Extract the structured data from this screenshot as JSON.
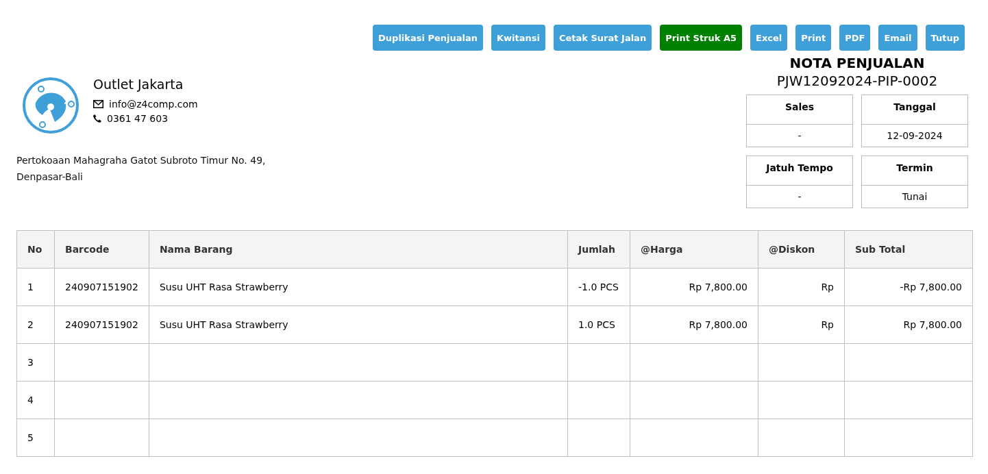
{
  "toolbar": [
    {
      "label": "Duplikasi Penjualan",
      "color": "#3e9fd9"
    },
    {
      "label": "Kwitansi",
      "color": "#3e9fd9"
    },
    {
      "label": "Cetak Surat Jalan",
      "color": "#3e9fd9"
    },
    {
      "label": "Print Struk A5",
      "color": "#008000"
    },
    {
      "label": "Excel",
      "color": "#3e9fd9"
    },
    {
      "label": "Print",
      "color": "#3e9fd9"
    },
    {
      "label": "PDF",
      "color": "#3e9fd9"
    },
    {
      "label": "Email",
      "color": "#3e9fd9"
    },
    {
      "label": "Tutup",
      "color": "#3e9fd9"
    }
  ],
  "company": {
    "name": "Outlet Jakarta",
    "email": "info@z4comp.com",
    "phone": "0361 47 603",
    "address": [
      "Pertokoaan Mahagraha Gatot Subroto Timur No. 49,",
      "Denpasar-Bali"
    ]
  },
  "nota": {
    "title": "NOTA PENJUALAN",
    "number": "PJW12092024-PIP-0002",
    "fields": [
      {
        "label": "Sales",
        "value": "-"
      },
      {
        "label": "Tanggal",
        "value": "12-09-2024"
      },
      {
        "label": "Jatuh Tempo",
        "value": "-"
      },
      {
        "label": "Termin",
        "value": "Tunai"
      }
    ]
  },
  "table": {
    "columns": [
      "No",
      "Barcode",
      "Nama Barang",
      "Jumlah",
      "@Harga",
      "@Diskon",
      "Sub Total"
    ],
    "rows": [
      [
        "1",
        "240907151902",
        "Susu UHT Rasa Strawberry",
        "-1.0 PCS",
        "Rp 7,800.00",
        "Rp",
        "-Rp 7,800.00"
      ],
      [
        "2",
        "240907151902",
        "Susu UHT Rasa Strawberry",
        "1.0 PCS",
        "Rp 7,800.00",
        "Rp",
        "Rp 7,800.00"
      ],
      [
        "3",
        "",
        "",
        "",
        "",
        "",
        ""
      ],
      [
        "4",
        "",
        "",
        "",
        "",
        "",
        ""
      ],
      [
        "5",
        "",
        "",
        "",
        "",
        "",
        ""
      ]
    ]
  }
}
